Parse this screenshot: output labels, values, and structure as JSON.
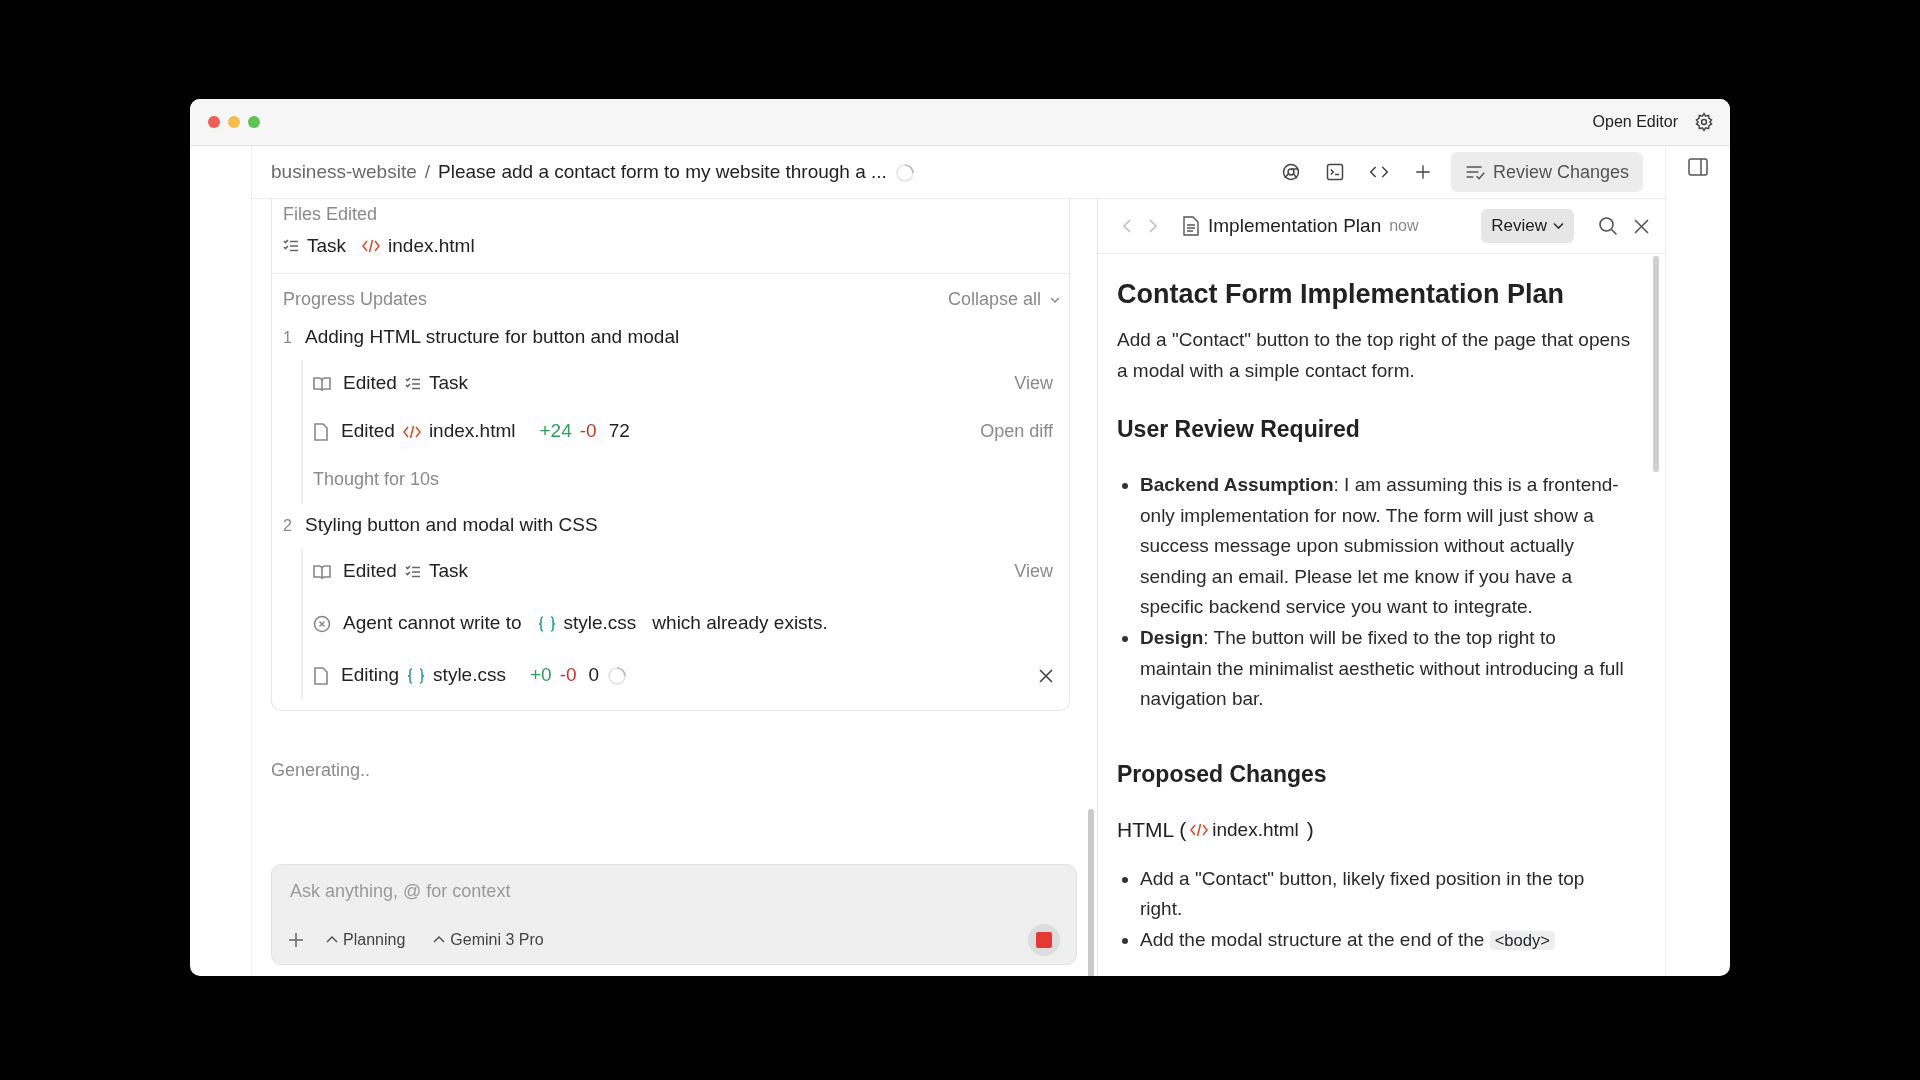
{
  "title_bar": {
    "open_editor": "Open Editor"
  },
  "header": {
    "project": "business-website",
    "separator": "/",
    "title": "Please add a contact form to my website through a ...",
    "loading": true,
    "review_changes": "Review Changes"
  },
  "files_edited": {
    "heading": "Files Edited",
    "files": [
      {
        "kind": "task",
        "name": "Task"
      },
      {
        "kind": "html",
        "name": "index.html"
      }
    ]
  },
  "progress": {
    "heading": "Progress Updates",
    "collapse_label": "Collapse all",
    "steps": [
      {
        "number": "1",
        "title": "Adding HTML structure for button and modal",
        "items": [
          {
            "kind": "edit",
            "verb": "Edited",
            "file": {
              "kind": "task",
              "name": "Task"
            },
            "action": "View"
          },
          {
            "kind": "edit",
            "verb": "Edited",
            "file": {
              "kind": "html",
              "name": "index.html"
            },
            "added": "+24",
            "removed": "-0",
            "lines": "72",
            "action": "Open diff"
          },
          {
            "kind": "thought",
            "text": "Thought for 10s"
          }
        ]
      },
      {
        "number": "2",
        "title": "Styling button and modal with CSS",
        "items": [
          {
            "kind": "edit",
            "verb": "Edited",
            "file": {
              "kind": "task",
              "name": "Task"
            },
            "action": "View"
          },
          {
            "kind": "error",
            "before": "Agent cannot write to",
            "file": {
              "kind": "css",
              "name": "style.css"
            },
            "after": "which already exists."
          },
          {
            "kind": "edit",
            "verb": "Editing",
            "file": {
              "kind": "css",
              "name": "style.css"
            },
            "added": "+0",
            "removed": "-0",
            "lines": "0",
            "running": true,
            "cancelable": true
          }
        ]
      }
    ]
  },
  "status": "Generating..",
  "composer": {
    "placeholder": "Ask anything, @ for context",
    "mode": "Planning",
    "model": "Gemini 3 Pro",
    "running": true
  },
  "document": {
    "title": "Implementation Plan",
    "time": "now",
    "review": "Review",
    "blocks": [
      {
        "kind": "h1",
        "text": "Contact Form Implementation Plan"
      },
      {
        "kind": "p",
        "text": "Add a \"Contact\" button to the top right of the page that opens a modal with a simple contact form."
      },
      {
        "kind": "h2",
        "text": "User Review Required"
      },
      {
        "kind": "list",
        "items": [
          {
            "text": "**Backend Assumption**: I am assuming this is a frontend-only implementation for now. The form will just show a success message upon submission without actually sending an email. Please let me know if you have a specific backend service you want to integrate."
          },
          {
            "text": "**Design**: The button will be fixed to the top right to maintain the minimalist aesthetic without introducing a full navigation bar."
          }
        ]
      },
      {
        "kind": "h2",
        "text": "Proposed Changes"
      },
      {
        "kind": "h3",
        "before": "HTML (",
        "file": {
          "kind": "html",
          "name": "index.html"
        },
        "after": ")"
      },
      {
        "kind": "list",
        "items": [
          {
            "text": "Add a \"Contact\" button, likely fixed position in the top right."
          },
          {
            "text": "Add the modal structure at the end of the",
            "code": "<body>"
          }
        ]
      }
    ]
  }
}
